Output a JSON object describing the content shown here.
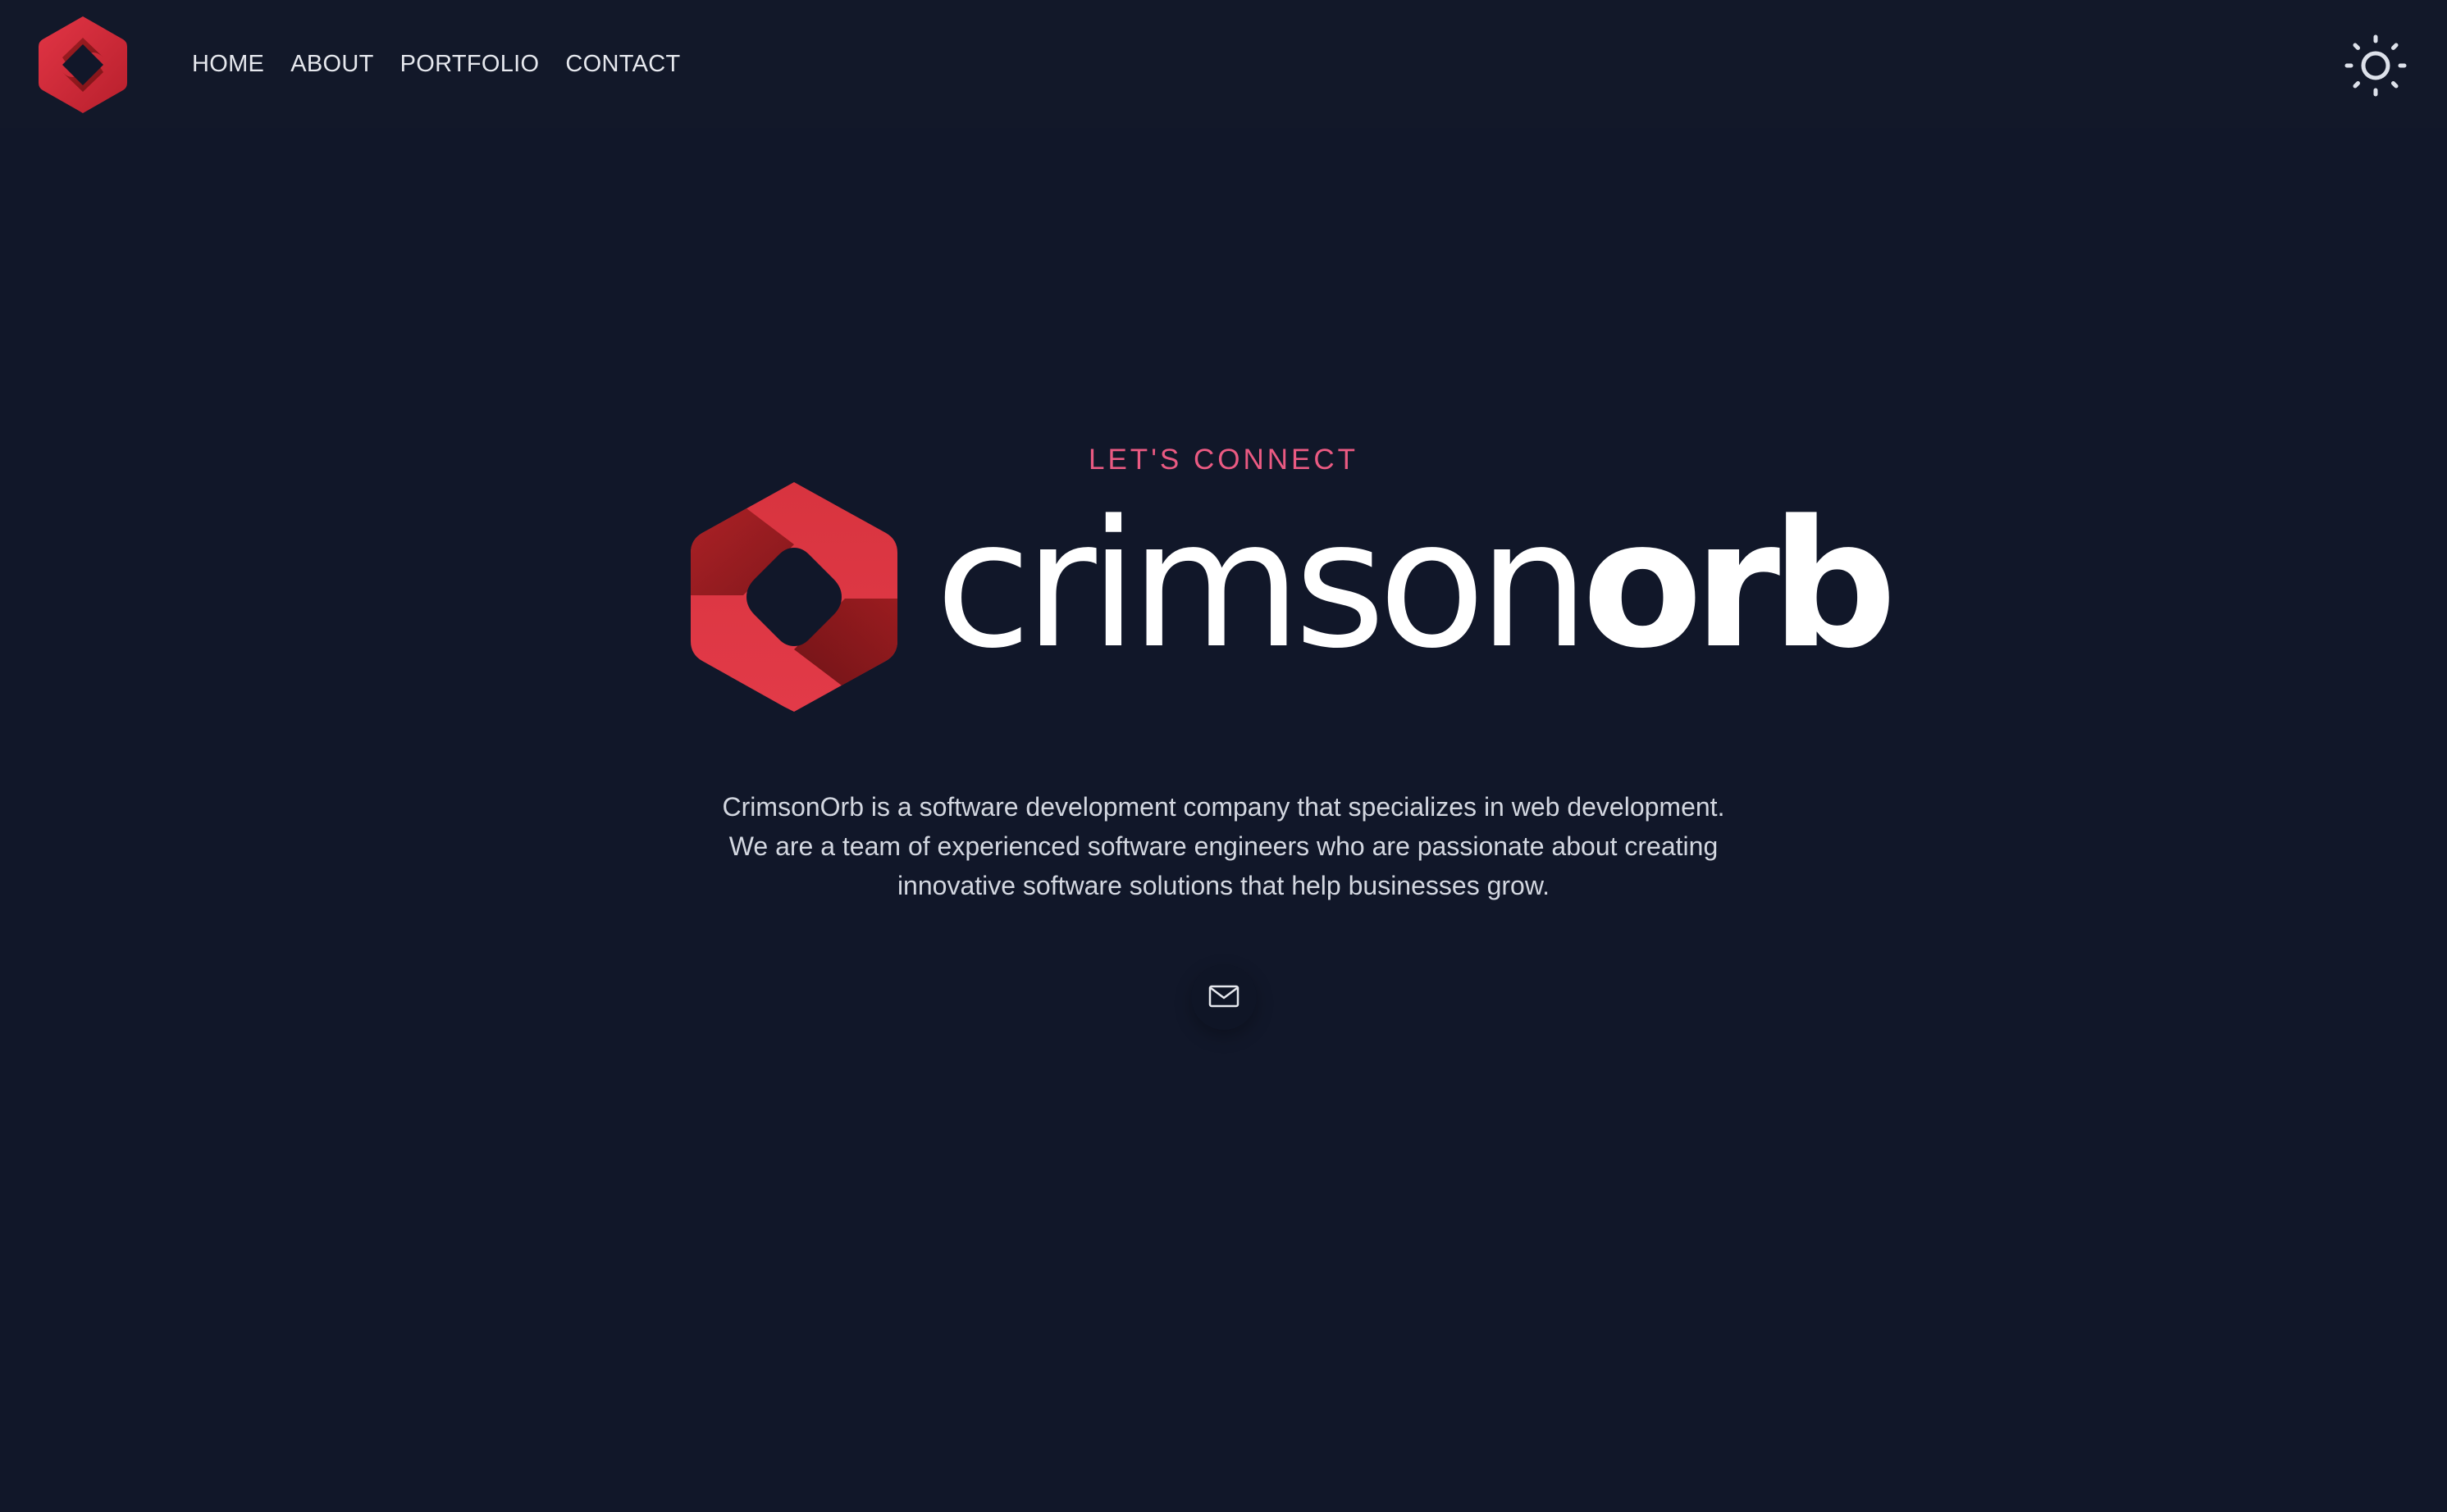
{
  "header": {
    "logo_icon": "crimsonorb-logo-icon",
    "nav": [
      {
        "label": "HOME"
      },
      {
        "label": "ABOUT"
      },
      {
        "label": "PORTFOLIO"
      },
      {
        "label": "CONTACT"
      }
    ],
    "theme_toggle_icon": "sun-icon"
  },
  "hero": {
    "eyebrow": "LET'S CONNECT",
    "brand": {
      "word_light": "crimson",
      "word_bold": "orb",
      "mark_icon": "crimsonorb-logo-icon"
    },
    "intro": "CrimsonOrb is a software development company that specializes in web development. We are a team of experienced software engineers who are passionate about creating innovative software solutions that help businesses grow.",
    "contact_icon": "mail-icon"
  },
  "colors": {
    "background": "#111729",
    "accent": "#ea5a82",
    "brand_red": "#d42f3f",
    "brand_dark_red": "#8c1818",
    "text": "#ffffff",
    "muted_text": "#d3d7e0"
  }
}
